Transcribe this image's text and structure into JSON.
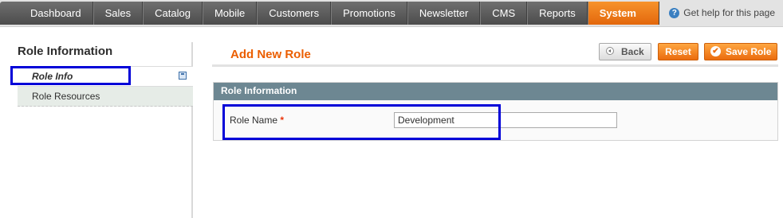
{
  "nav": {
    "items": [
      {
        "label": "Dashboard"
      },
      {
        "label": "Sales"
      },
      {
        "label": "Catalog"
      },
      {
        "label": "Mobile"
      },
      {
        "label": "Customers"
      },
      {
        "label": "Promotions"
      },
      {
        "label": "Newsletter"
      },
      {
        "label": "CMS"
      },
      {
        "label": "Reports"
      },
      {
        "label": "System"
      }
    ],
    "active": "System",
    "help_label": "Get help for this page",
    "help_icon": "?"
  },
  "sidebar": {
    "title": "Role Information",
    "tabs": [
      {
        "label": "Role Info",
        "active": true
      },
      {
        "label": "Role Resources",
        "active": false
      }
    ]
  },
  "main": {
    "title": "Add New Role",
    "buttons": {
      "back": "Back",
      "reset": "Reset",
      "save": "Save Role"
    },
    "section": {
      "title": "Role Information",
      "field_label": "Role Name",
      "required_mark": "*",
      "field_value": "Development"
    }
  },
  "colors": {
    "accent": "#eb6c0e",
    "section_header": "#6d8792",
    "highlight_box": "#0000d8"
  }
}
